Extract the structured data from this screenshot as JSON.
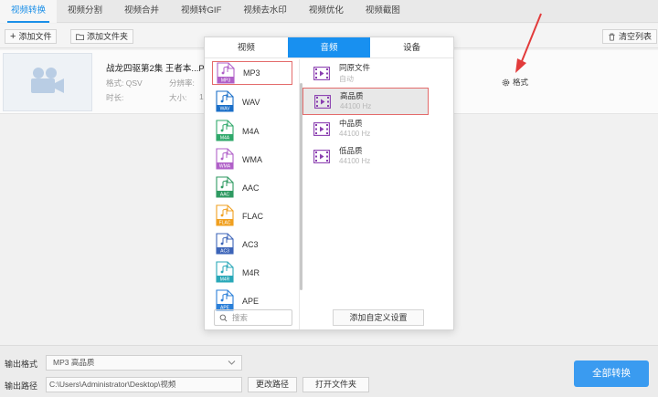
{
  "nav": {
    "tabs": [
      "视频转换",
      "视频分割",
      "视频合并",
      "视频转GIF",
      "视频去水印",
      "视频优化",
      "视频截图"
    ]
  },
  "toolbar": {
    "add_file": "添加文件",
    "add_folder": "添加文件夹",
    "clear_list": "清空列表"
  },
  "file": {
    "title": "战龙四驱第2集 王者本...P...",
    "format_label": "格式: QSV",
    "duration_label": "时长:",
    "resolution_label": "分辨率:",
    "size_label": "大小:",
    "size_value_partial": "1",
    "format_button": "格式"
  },
  "panel": {
    "tabs": [
      "视频",
      "音频",
      "设备"
    ],
    "active_tab": 1,
    "formats": [
      {
        "name": "MP3",
        "color": "#b060c8",
        "selected": true
      },
      {
        "name": "WAV",
        "color": "#1b6fc8",
        "selected": false
      },
      {
        "name": "M4A",
        "color": "#2fa86a",
        "selected": false
      },
      {
        "name": "WMA",
        "color": "#b060c8",
        "selected": false
      },
      {
        "name": "AAC",
        "color": "#2f9a62",
        "selected": false
      },
      {
        "name": "FLAC",
        "color": "#f0a020",
        "selected": false
      },
      {
        "name": "AC3",
        "color": "#3c64b8",
        "selected": false
      },
      {
        "name": "M4R",
        "color": "#29a8b8",
        "selected": false
      },
      {
        "name": "APE",
        "color": "#2a7fd8",
        "selected": false
      }
    ],
    "qualities": [
      {
        "name": "同原文件",
        "sub": "自动",
        "selected": false
      },
      {
        "name": "高品质",
        "sub": "44100 Hz",
        "selected": true
      },
      {
        "name": "中品质",
        "sub": "44100 Hz",
        "selected": false
      },
      {
        "name": "低品质",
        "sub": "44100 Hz",
        "selected": false
      }
    ],
    "search_placeholder": "搜索",
    "add_custom": "添加自定义设置"
  },
  "bottom": {
    "output_format_label": "输出格式",
    "output_format_value": "MP3   高品质",
    "output_path_label": "输出路径",
    "output_path_value": "C:\\Users\\Administrator\\Desktop\\视频",
    "change_path": "更改路径",
    "open_folder": "打开文件夹",
    "convert_all": "全部转换"
  },
  "colors": {
    "accent": "#1890f0",
    "highlight_border": "#e36b6b",
    "annotation_arrow": "#e23b3b"
  }
}
